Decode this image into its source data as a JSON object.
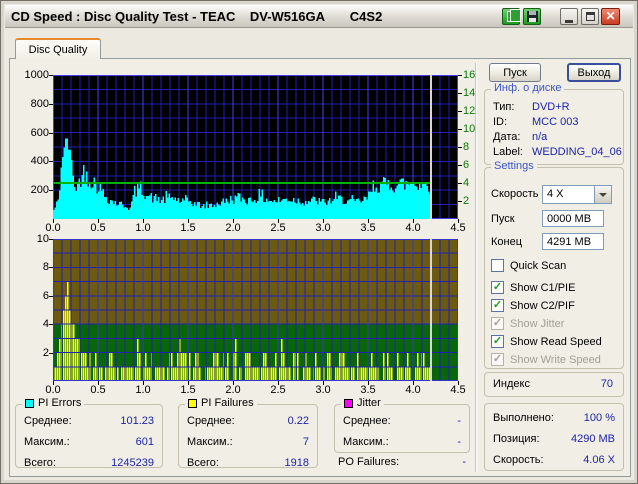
{
  "window": {
    "title": "CD Speed : Disc Quality Test - TEAC    DV-W516GA       C4S2"
  },
  "icons": {
    "close_glyph": "✕",
    "check_glyph": "✓"
  },
  "tab": {
    "label": "Disc Quality"
  },
  "buttons": {
    "start": "Пуск",
    "exit": "Выход"
  },
  "disc_info": {
    "caption": "Инф. о диске",
    "rows": [
      {
        "label": "Тип:",
        "value": "DVD+R"
      },
      {
        "label": "ID:",
        "value": "MCC 003"
      },
      {
        "label": "Дата:",
        "value": "n/a"
      },
      {
        "label": "Label:",
        "value": "WEDDING_04_06"
      }
    ]
  },
  "settings": {
    "caption": "Settings",
    "speed_label": "Скорость",
    "speed_value": "4 X",
    "start_label": "Пуск",
    "start_value": "0000 MB",
    "end_label": "Конец",
    "end_value": "4291 MB",
    "checkboxes": [
      {
        "label": "Quick Scan",
        "checked": false,
        "enabled": true
      },
      {
        "label": "Show C1/PIE",
        "checked": true,
        "enabled": true
      },
      {
        "label": "Show C2/PIF",
        "checked": true,
        "enabled": true
      },
      {
        "label": "Show Jitter",
        "checked": true,
        "enabled": false
      },
      {
        "label": "Show Read Speed",
        "checked": true,
        "enabled": true
      },
      {
        "label": "Show Write Speed",
        "checked": true,
        "enabled": false
      }
    ]
  },
  "index_box": {
    "label": "Индекс",
    "value": "70"
  },
  "progress_box": {
    "rows": [
      {
        "label": "Выполнено:",
        "value": "100 %"
      },
      {
        "label": "Позиция:",
        "value": "4290 MB"
      },
      {
        "label": "Скорость:",
        "value": "4.06 X"
      }
    ]
  },
  "stats": {
    "pi_errors": {
      "caption": "PI Errors",
      "legend_color": "#00ffff",
      "rows": [
        {
          "label": "Среднее:",
          "value": "101.23"
        },
        {
          "label": "Максим.:",
          "value": "601"
        },
        {
          "label": "Всего:",
          "value": "1245239"
        }
      ]
    },
    "pi_failures": {
      "caption": "PI Failures",
      "legend_color": "#ffff00",
      "rows": [
        {
          "label": "Среднее:",
          "value": "0.22"
        },
        {
          "label": "Максим.:",
          "value": "7"
        },
        {
          "label": "Всего:",
          "value": "1918"
        }
      ]
    },
    "jitter": {
      "caption": "Jitter",
      "legend_color": "#ff00ff",
      "rows": [
        {
          "label": "Среднее:",
          "value": "-"
        },
        {
          "label": "Максим.:",
          "value": "-"
        }
      ]
    },
    "po_failures": {
      "label": "PO Failures:",
      "value": "-"
    }
  },
  "chart_data": [
    {
      "id": "pi-errors-chart",
      "type": "area",
      "render": "area",
      "title": "PI Errors vs position (GB)",
      "series_name": "PI Errors",
      "seed": 42,
      "bg": "#000000",
      "color": "#00ffff",
      "grid_color": "#2121b4",
      "grid_major_color": "#4040e8",
      "grid_over_data": false,
      "x_range": [
        0,
        4.5
      ],
      "x_minor_step": 0.1,
      "x_major_step": 0.5,
      "x_ticks": [
        "0.0",
        "0.5",
        "1.0",
        "1.5",
        "2.0",
        "2.5",
        "3.0",
        "3.5",
        "4.0",
        "4.5"
      ],
      "y_left_range": [
        0,
        1000
      ],
      "y_left_grid_step": 100,
      "y_left_ticks": [
        200,
        400,
        600,
        800,
        1000
      ],
      "y_right_range": [
        0,
        16
      ],
      "y_right_ticks": [
        2,
        4,
        6,
        8,
        10,
        12,
        14,
        16
      ],
      "read_speed_line": {
        "value": 4,
        "axis": "right",
        "color": "#00b400"
      },
      "cursor_x": 4.2,
      "cursor_color": "#d8d8d8",
      "data_end_x": 4.2,
      "x_start": 0,
      "x_step": 0.05,
      "values": [
        60,
        130,
        480,
        601,
        420,
        200,
        310,
        340,
        290,
        260,
        235,
        185,
        150,
        125,
        115,
        105,
        95,
        75,
        195,
        225,
        205,
        165,
        150,
        145,
        135,
        145,
        155,
        145,
        130,
        120,
        130,
        115,
        105,
        95,
        90,
        100,
        105,
        115,
        125,
        135,
        145,
        155,
        145,
        135,
        140,
        150,
        155,
        145,
        135,
        125,
        130,
        135,
        145,
        140,
        135,
        130,
        125,
        130,
        135,
        125,
        120,
        125,
        135,
        145,
        140,
        135,
        125,
        120,
        125,
        135,
        160,
        235,
        245,
        240,
        250,
        255,
        245,
        255,
        250,
        255,
        260,
        255,
        250,
        245,
        235
      ]
    },
    {
      "id": "pi-failures-chart",
      "type": "bar",
      "render": "bars",
      "title": "PI Failures vs position (GB)",
      "series_name": "PI Failures",
      "seed": 1337,
      "bar_color": "#ffff00",
      "bg_zones": [
        {
          "from": 4,
          "to": 10,
          "color": "#6b5a10"
        },
        {
          "from": 0,
          "to": 4,
          "color": "#0a660a"
        }
      ],
      "grid_color": "#2121b4",
      "grid_major_color": "#3434d0",
      "grid_over_data": true,
      "x_range": [
        0,
        4.5
      ],
      "x_minor_step": 0.1,
      "x_major_step": 0.5,
      "x_ticks": [
        "0.0",
        "0.5",
        "1.0",
        "1.5",
        "2.0",
        "2.5",
        "3.0",
        "3.5",
        "4.0",
        "4.5"
      ],
      "y_left_range": [
        0,
        10
      ],
      "y_left_grid_step": 1,
      "y_left_ticks": [
        2,
        4,
        6,
        8,
        10
      ],
      "cursor_x": 4.2,
      "cursor_color": "#d8d8d8",
      "data_end_x": 4.2,
      "x_start": 0,
      "x_step": 0.05,
      "values": [
        1,
        2,
        4,
        7,
        4,
        3,
        3,
        2,
        2,
        2,
        1,
        1,
        2,
        2,
        1,
        1,
        1,
        1,
        1,
        2,
        1,
        1,
        2,
        1,
        1,
        2,
        2,
        1,
        2,
        2,
        1,
        1,
        2,
        1,
        1,
        1,
        2,
        1,
        2,
        1,
        2,
        1,
        1,
        2,
        1,
        1,
        1,
        2,
        1,
        1,
        1,
        2,
        1,
        1,
        2,
        1,
        1,
        1,
        2,
        1,
        1,
        2,
        1,
        1,
        2,
        1,
        1,
        1,
        2,
        1,
        1,
        2,
        1,
        2,
        1,
        1,
        2,
        1,
        1,
        2,
        1,
        1,
        2,
        1,
        1
      ]
    }
  ]
}
